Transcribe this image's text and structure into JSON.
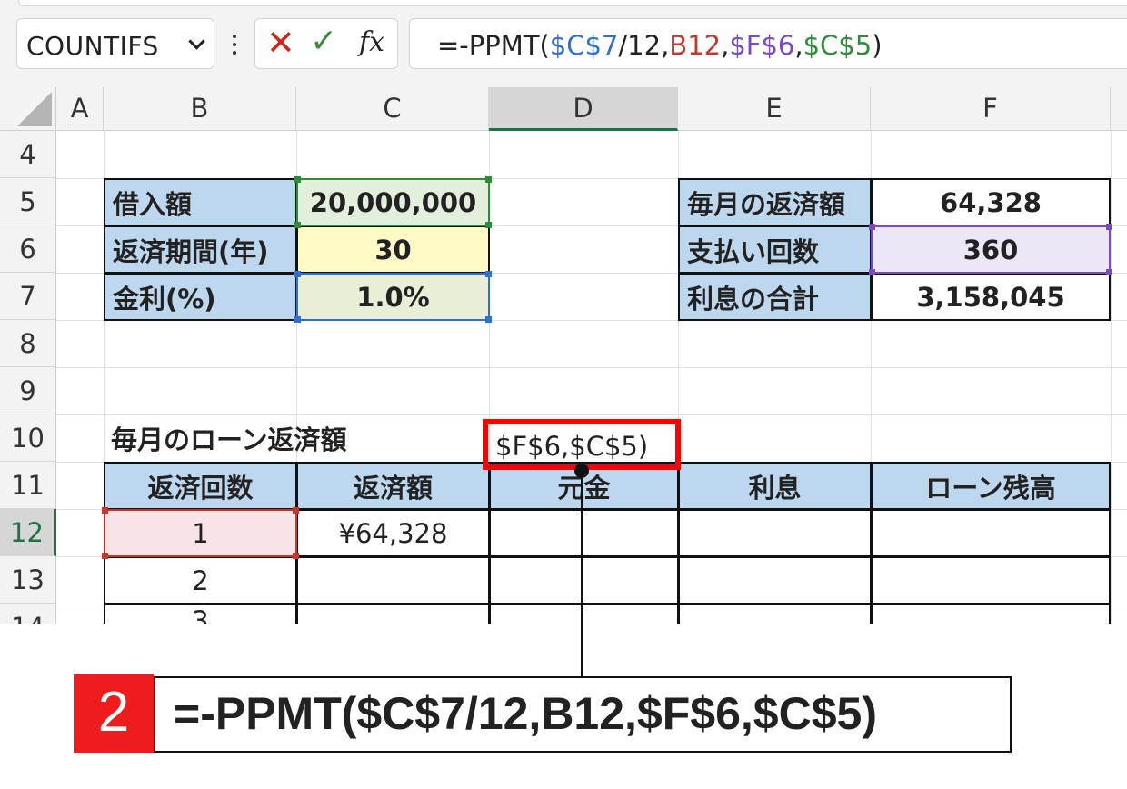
{
  "formula_bar": {
    "name_box": "COUNTIFS",
    "cancel_icon": "✕",
    "enter_icon": "✓",
    "fx_label": "fx",
    "formula_parts": [
      {
        "text": "=-PPMT(",
        "color": "default"
      },
      {
        "text": "$C$7",
        "color": "blue"
      },
      {
        "text": "/12,",
        "color": "default"
      },
      {
        "text": "B12",
        "color": "red"
      },
      {
        "text": ",",
        "color": "default"
      },
      {
        "text": "$F$6",
        "color": "purple"
      },
      {
        "text": ",",
        "color": "default"
      },
      {
        "text": "$C$5",
        "color": "green"
      },
      {
        "text": ")",
        "color": "default"
      }
    ]
  },
  "columns": [
    "A",
    "B",
    "C",
    "D",
    "E",
    "F"
  ],
  "rows": [
    "4",
    "5",
    "6",
    "7",
    "8",
    "9",
    "10",
    "11",
    "12",
    "13",
    "14"
  ],
  "loan_inputs": {
    "rows": [
      {
        "label": "借入額",
        "value": "20,000,000"
      },
      {
        "label": "返済期間(年)",
        "value": "30"
      },
      {
        "label": "金利(%)",
        "value": "1.0%"
      }
    ]
  },
  "summary": {
    "rows": [
      {
        "label": "毎月の返済額",
        "value": "64,328"
      },
      {
        "label": "支払い回数",
        "value": "360"
      },
      {
        "label": "利息の合計",
        "value": "3,158,045"
      }
    ]
  },
  "table": {
    "title": "毎月のローン返済額",
    "headers": [
      "返済回数",
      "返済額",
      "元金",
      "利息",
      "ローン残高"
    ],
    "rows": [
      {
        "n": "1",
        "payment": "¥64,328",
        "principal_editing": "$F$6,$C$5)",
        "interest": "",
        "balance": ""
      },
      {
        "n": "2",
        "payment": "",
        "principal_editing": "",
        "interest": "",
        "balance": ""
      },
      {
        "n": "3",
        "payment": "",
        "principal_editing": "",
        "interest": "",
        "balance": ""
      }
    ]
  },
  "annotation": {
    "step": "2",
    "text": "=-PPMT($C$7/12,B12,$F$6,$C$5)"
  },
  "colors": {
    "label_fill": "#bdd7ee",
    "green_ref": "#2e8b3a",
    "blue_ref": "#2f6fd6",
    "purple_ref": "#7a4bbf",
    "red_ref": "#c0392b",
    "callout_badge": "#ee1c1c"
  }
}
